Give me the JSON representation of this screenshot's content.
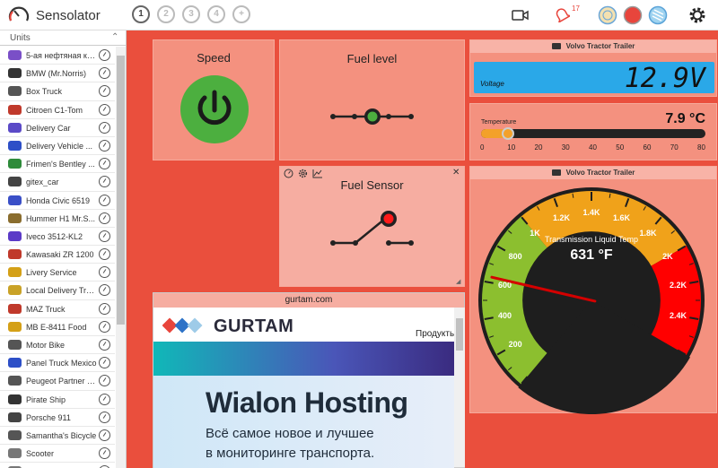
{
  "app": {
    "title": "Sensolator"
  },
  "pages": [
    "1",
    "2",
    "3",
    "4",
    "+"
  ],
  "header": {
    "notification_count": "17"
  },
  "sidebar": {
    "header": "Units",
    "units": [
      {
        "name": "5-ая нефтяная ко...",
        "color": "#7a4fc7"
      },
      {
        "name": "BMW (Mr.Norris)",
        "color": "#333333"
      },
      {
        "name": "Box Truck",
        "color": "#555555"
      },
      {
        "name": "Citroen C1-Tom",
        "color": "#c0392b"
      },
      {
        "name": "Delivery Car",
        "color": "#5b4ac7"
      },
      {
        "name": "Delivery Vehicle ...",
        "color": "#2d4fc7"
      },
      {
        "name": "Frimen's Bentley ...",
        "color": "#2e8b3a"
      },
      {
        "name": "gitex_car",
        "color": "#444444"
      },
      {
        "name": "Honda Civic 6519",
        "color": "#3a4fc7"
      },
      {
        "name": "Hummer H1 Mr.S...",
        "color": "#8a6d2e"
      },
      {
        "name": "Iveco 3512-KL2",
        "color": "#5b3ac7"
      },
      {
        "name": "Kawasaki ZR 1200",
        "color": "#c0392b"
      },
      {
        "name": "Livery Service",
        "color": "#d4a017"
      },
      {
        "name": "Local Delivery Truck",
        "color": "#c9a227"
      },
      {
        "name": "MAZ Truck",
        "color": "#c0392b"
      },
      {
        "name": "MB E-8411 Food",
        "color": "#d4a017"
      },
      {
        "name": "Motor Bike",
        "color": "#555555"
      },
      {
        "name": "Panel Truck Mexico",
        "color": "#2d4fc7"
      },
      {
        "name": "Peugeot Partner 6...",
        "color": "#555555"
      },
      {
        "name": "Pirate Ship",
        "color": "#333333"
      },
      {
        "name": "Porsche 911",
        "color": "#444444"
      },
      {
        "name": "Samantha's Bicycle",
        "color": "#555555"
      },
      {
        "name": "Scooter",
        "color": "#777777"
      },
      {
        "name": "Skoda ...",
        "color": "#777777"
      }
    ]
  },
  "widgets": {
    "speed": {
      "title": "Speed"
    },
    "fuel_level": {
      "title": "Fuel level"
    },
    "fuel_sensor": {
      "title": "Fuel Sensor"
    },
    "voltage": {
      "unit": "Volvo Tractor Trailer",
      "label": "Voltage",
      "value": "12.9V"
    },
    "temperature": {
      "label": "Temperature",
      "value": "7.9 °C",
      "level": 7.9,
      "min": 0,
      "max": 80,
      "ticks": [
        "0",
        "10",
        "20",
        "30",
        "40",
        "50",
        "60",
        "70",
        "80"
      ]
    },
    "gauge": {
      "unit": "Volvo Tractor Trailer",
      "label": "Transmission Liquid Temp",
      "value": "631 °F",
      "reading": 631,
      "tick_labels": [
        "200",
        "400",
        "600",
        "800",
        "1K",
        "1.2K",
        "1.4K",
        "1.6K",
        "1.8K",
        "2K",
        "2.2K",
        "2.4K"
      ]
    },
    "web": {
      "title": "gurtam.com",
      "brand": "GURTAM",
      "nav": "Продукты",
      "headline": "Wialon Hosting",
      "subline1": "Всё самое новое и лучшее",
      "subline2": "в мониторинге транспорта."
    }
  },
  "colors": {
    "background": "#ea4f3d",
    "widget": "#f4917f",
    "green": "#4caf3f",
    "gauge_green": "#8cbf2f",
    "gauge_orange": "#f0a21a",
    "gauge_red": "#ff0000",
    "lcd": "#2aa8e8"
  }
}
